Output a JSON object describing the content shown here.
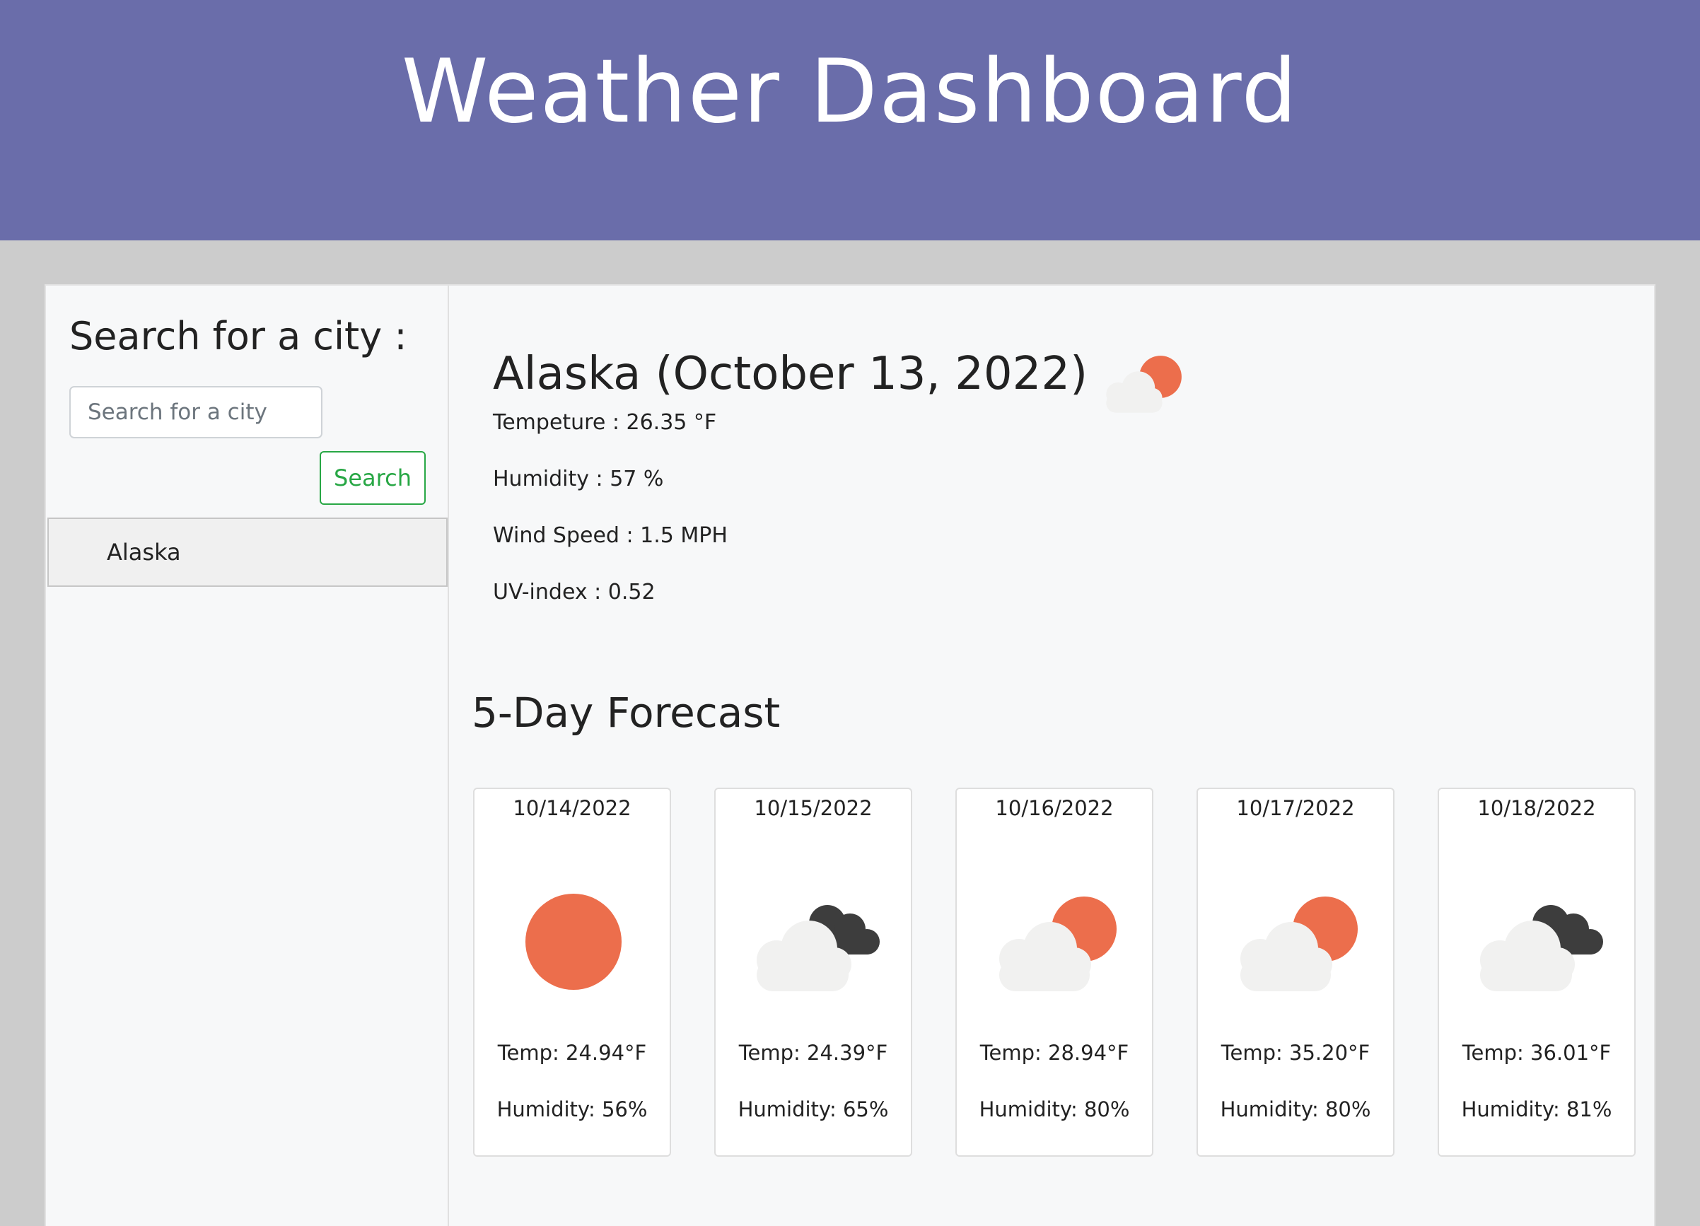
{
  "header": {
    "title": "Weather Dashboard"
  },
  "sidebar": {
    "heading": "Search for a city :",
    "search_placeholder": "Search for a city",
    "search_value": "",
    "search_button": "Search",
    "history": [
      {
        "label": "Alaska"
      }
    ]
  },
  "current": {
    "title": "Alaska (October 13, 2022)",
    "icon": "few-clouds-day-icon",
    "temperature": "Tempeture : 26.35 °F",
    "humidity": "Humidity : 57 %",
    "wind": "Wind Speed : 1.5 MPH",
    "uv": "UV-index : 0.52"
  },
  "forecast": {
    "heading": "5-Day Forecast",
    "days": [
      {
        "date": "10/14/2022",
        "icon": "clear-sky-icon",
        "temp": "Temp: 24.94°F",
        "humidity": "Humidity: 56%"
      },
      {
        "date": "10/15/2022",
        "icon": "broken-clouds-icon",
        "temp": "Temp: 24.39°F",
        "humidity": "Humidity: 65%"
      },
      {
        "date": "10/16/2022",
        "icon": "few-clouds-day-icon",
        "temp": "Temp: 28.94°F",
        "humidity": "Humidity: 80%"
      },
      {
        "date": "10/17/2022",
        "icon": "few-clouds-day-icon",
        "temp": "Temp: 35.20°F",
        "humidity": "Humidity: 80%"
      },
      {
        "date": "10/18/2022",
        "icon": "broken-clouds-icon",
        "temp": "Temp: 36.01°F",
        "humidity": "Humidity: 81%"
      }
    ]
  },
  "colors": {
    "header": "#6a6daa",
    "sun": "#ec6e4c",
    "cloud_light": "#f1f1f0",
    "cloud_dark": "#3d3d3d",
    "search_button": "#28a745"
  }
}
